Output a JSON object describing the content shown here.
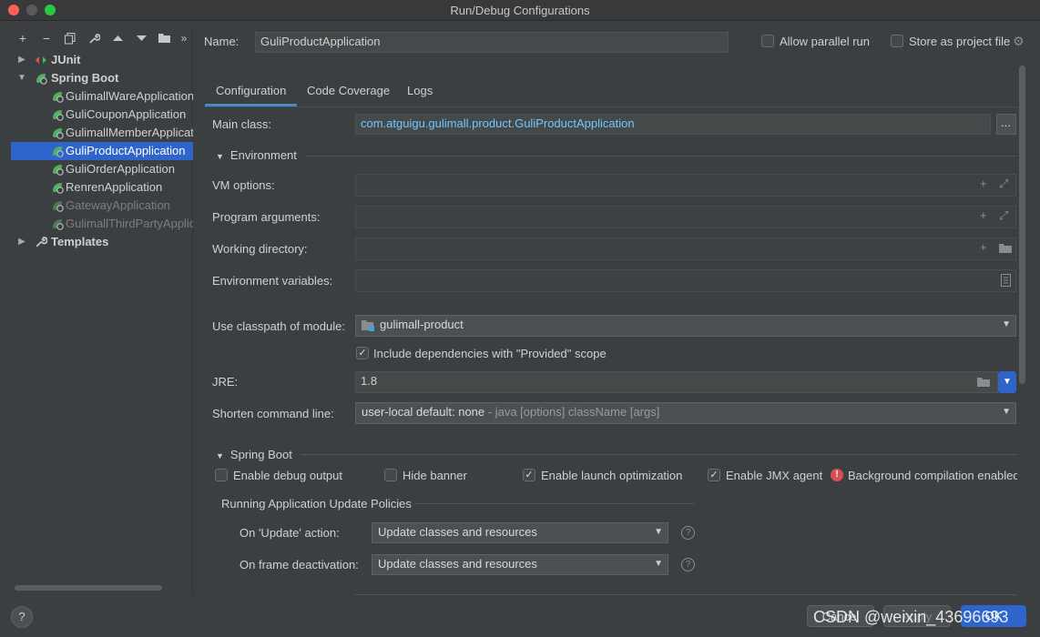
{
  "window": {
    "title": "Run/Debug Configurations"
  },
  "toolbar": {
    "icons": [
      "add-icon",
      "remove-icon",
      "copy-icon",
      "wrench-icon",
      "up-icon",
      "down-icon",
      "folder-icon",
      "more-icon"
    ],
    "more_glyph": "»"
  },
  "tree": {
    "junit": "JUnit",
    "spring_boot": "Spring Boot",
    "apps": [
      {
        "label": "GulimallWareApplication",
        "state": "normal"
      },
      {
        "label": "GuliCouponApplication",
        "state": "normal"
      },
      {
        "label": "GulimallMemberApplication",
        "state": "normal"
      },
      {
        "label": "GuliProductApplication",
        "state": "selected"
      },
      {
        "label": "GuliOrderApplication",
        "state": "normal"
      },
      {
        "label": "RenrenApplication",
        "state": "normal"
      },
      {
        "label": "GatewayApplication",
        "state": "dim"
      },
      {
        "label": "GulimallThirdPartyApplication",
        "state": "dim"
      }
    ],
    "templates": "Templates"
  },
  "header": {
    "name_label": "Name:",
    "name_value": "GuliProductApplication",
    "allow_parallel": "Allow parallel run",
    "store_as_file": "Store as project file"
  },
  "tabs": [
    "Configuration",
    "Code Coverage",
    "Logs"
  ],
  "config": {
    "main_class_label": "Main class:",
    "main_class_value": "com.atguigu.gulimall.product.GuliProductApplication",
    "browse_label": "...",
    "environment": "Environment",
    "vm_options": "VM options:",
    "program_args": "Program arguments:",
    "working_dir": "Working directory:",
    "env_vars": "Environment variables:",
    "classpath_label": "Use classpath of module:",
    "classpath_value": "gulimall-product",
    "include_deps": "Include dependencies with \"Provided\" scope",
    "jre_label": "JRE:",
    "jre_value": "1.8",
    "shorten_label": "Shorten command line:",
    "shorten_value": "user-local default: none",
    "shorten_hint": " - java [options] className [args]"
  },
  "spring_boot": {
    "section": "Spring Boot",
    "debug_output": "Enable debug output",
    "hide_banner": "Hide banner",
    "launch_opt": "Enable launch optimization",
    "jmx_agent": "Enable JMX agent",
    "bg_compile": "Background compilation enabled",
    "policies_title": "Running Application Update Policies",
    "on_update_label": "On 'Update' action:",
    "on_update_value": "Update classes and resources",
    "on_frame_label": "On frame deactivation:",
    "on_frame_value": "Update classes and resources"
  },
  "footer": {
    "help": "?",
    "cancel": "Cancel",
    "apply": "Apply",
    "ok": "OK"
  },
  "watermark": "CSDN @weixin_43696693",
  "colors": {
    "accent": "#2f65ca",
    "link": "#6fc7ff",
    "error": "#d75050",
    "bg": "#3c3f41"
  }
}
